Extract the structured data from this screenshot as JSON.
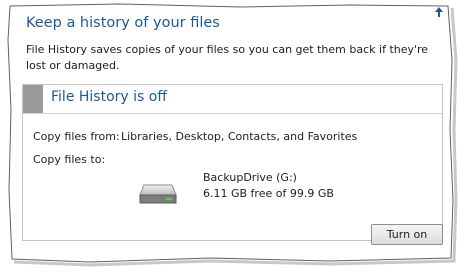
{
  "page": {
    "title": "Keep a history of your files",
    "description": "File History saves copies of your files so you can get them back if they're lost or damaged."
  },
  "status": {
    "text": "File History is off"
  },
  "copy_from": {
    "label": "Copy files from:",
    "value": "Libraries, Desktop, Contacts, and Favorites"
  },
  "copy_to": {
    "label": "Copy files to:",
    "drive_name": "BackupDrive (G:)",
    "drive_space": "6.11 GB free of 99.9 GB",
    "icon": "hard-drive-icon"
  },
  "actions": {
    "turn_on_label": "Turn on"
  },
  "colors": {
    "accent": "#1b5a9a",
    "status_stripe": "#9a9a9a"
  }
}
